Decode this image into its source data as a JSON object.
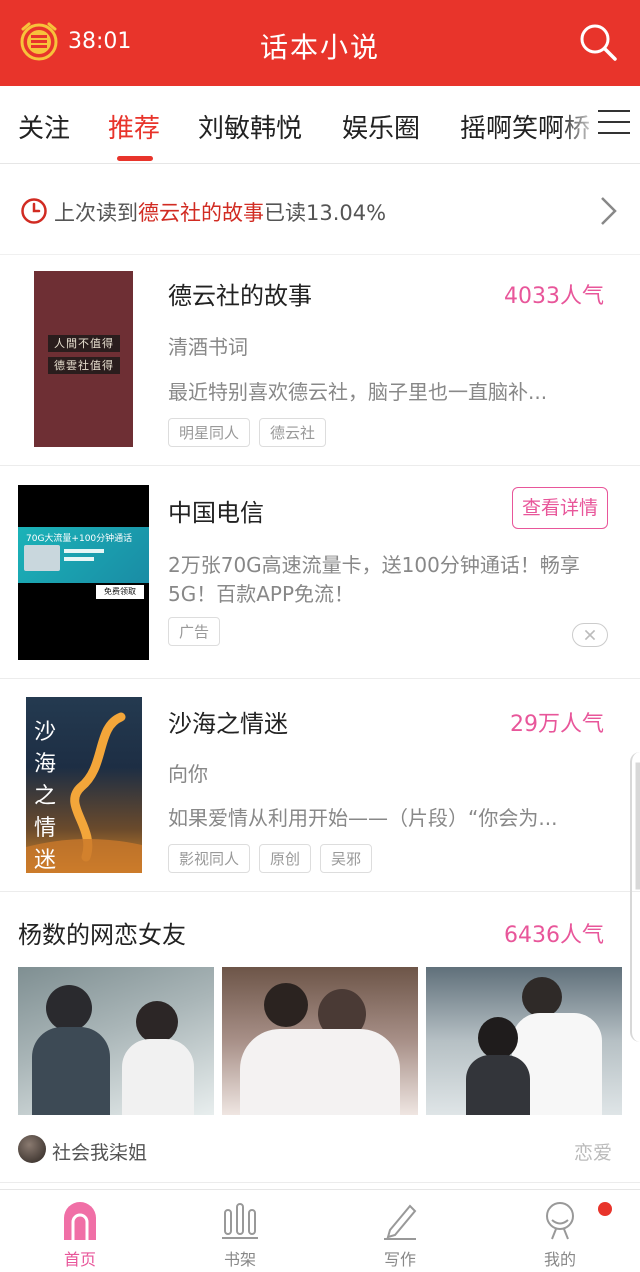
{
  "header": {
    "timer": "38:01",
    "title": "话本小说"
  },
  "tabs": [
    "关注",
    "推荐",
    "刘敏韩悦",
    "娱乐圈",
    "摇啊笑啊桥"
  ],
  "last_read": {
    "prefix": "上次读到",
    "book": "德云社的故事",
    "suffix": "已读13.04%"
  },
  "books": [
    {
      "title": "德云社的故事",
      "popularity": "4033人气",
      "author": "清酒书词",
      "desc": "最近特别喜欢德云社，脑子里也一直脑补...",
      "tags": [
        "明星同人",
        "德云社"
      ],
      "cover_lines": [
        "人間不值得",
        "德雲社值得"
      ]
    },
    {
      "title": "沙海之情迷",
      "popularity": "29万人气",
      "author": "向你",
      "desc": "如果爱情从利用开始——（片段）“你会为...",
      "tags": [
        "影视同人",
        "原创",
        "吴邪"
      ],
      "cover_text": "沙海之情迷"
    }
  ],
  "ad": {
    "title": "中国电信",
    "button": "查看详情",
    "desc": "2万张70G高速流量卡，送100分钟通话！畅享5G！百款APP免流！",
    "tag": "广告",
    "banner_text": "70G大流量+100分钟通话",
    "banner_cta": "免费领取"
  },
  "collage": {
    "title": "杨数的网恋女友",
    "popularity": "6436人气",
    "author": "社会我柒姐",
    "genre": "恋爱"
  },
  "nav": [
    {
      "label": "首页",
      "icon": "home-icon",
      "active": true
    },
    {
      "label": "书架",
      "icon": "bookshelf-icon",
      "active": false
    },
    {
      "label": "写作",
      "icon": "pen-icon",
      "active": false
    },
    {
      "label": "我的",
      "icon": "profile-icon",
      "active": false
    }
  ],
  "colors": {
    "brand_red": "#e8342b",
    "pink": "#e8569a"
  }
}
